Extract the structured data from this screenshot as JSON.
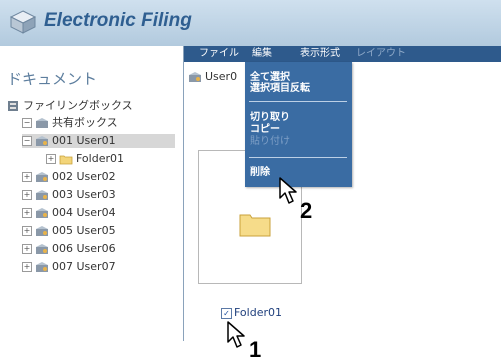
{
  "app": {
    "title": "Electronic Filing"
  },
  "menubar": {
    "items": [
      {
        "label": "ファイル",
        "enabled": true
      },
      {
        "label": "編集",
        "enabled": true
      },
      {
        "label": "表示形式",
        "enabled": true
      },
      {
        "label": "レイアウト",
        "enabled": false
      }
    ]
  },
  "sidebar": {
    "header": "ドキュメント",
    "tree": [
      {
        "label": "ファイリングボックス"
      },
      {
        "label": "共有ボックス",
        "expander": "−"
      },
      {
        "label": "001 User01",
        "expander": "−",
        "selected": true
      },
      {
        "label": "Folder01",
        "expander": "+"
      },
      {
        "label": "002 User02",
        "expander": "+"
      },
      {
        "label": "003 User03",
        "expander": "+"
      },
      {
        "label": "004 User04",
        "expander": "+"
      },
      {
        "label": "005 User05",
        "expander": "+"
      },
      {
        "label": "006 User06",
        "expander": "+"
      },
      {
        "label": "007 User07",
        "expander": "+"
      }
    ]
  },
  "main": {
    "path": "User0",
    "folder_checkbox_label": "Folder01",
    "folder_checked": true
  },
  "edit_menu": {
    "items": [
      {
        "label": "全て選択",
        "enabled": true
      },
      {
        "label": "選択項目反転",
        "enabled": true
      },
      {
        "label": "切り取り",
        "enabled": true
      },
      {
        "label": "コピー",
        "enabled": true
      },
      {
        "label": "貼り付け",
        "enabled": false
      },
      {
        "label": "削除",
        "enabled": true
      }
    ]
  },
  "callouts": {
    "step1": "1",
    "step2": "2"
  },
  "colors": {
    "menubar": "#2e5a8c",
    "dropdown": "#3a6ca3",
    "title": "#2f5f91"
  }
}
